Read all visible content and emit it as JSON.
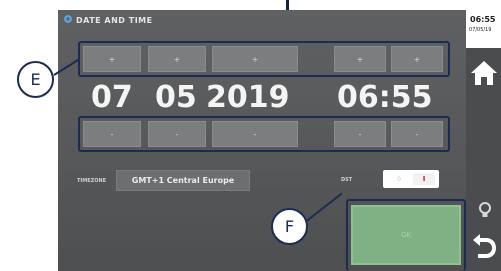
{
  "header": {
    "title": "DATE AND TIME"
  },
  "side": {
    "time": "06:55",
    "date": "07/05/19"
  },
  "callouts": {
    "e": "E",
    "f": "F"
  },
  "date_time": {
    "day": "07",
    "month": "05",
    "year": "2019",
    "time": "06:55"
  },
  "increment_buttons": [
    "+",
    "+",
    "+",
    "+",
    "+"
  ],
  "decrement_buttons": [
    "-",
    "-",
    "-",
    "-",
    "-"
  ],
  "timezone": {
    "label": "TIMEZONE",
    "value": "GMT+1 Central Europe"
  },
  "dst": {
    "label": "DST",
    "off_label": "0",
    "on_label": "I"
  },
  "ok_label": "OK",
  "colors": {
    "accent_line": "#1b2b52",
    "ok_green": "#7fb184",
    "dst_red": "#c2162b"
  },
  "icons": [
    "gear-icon",
    "home-icon",
    "lightbulb-icon",
    "back-arrow-icon"
  ]
}
